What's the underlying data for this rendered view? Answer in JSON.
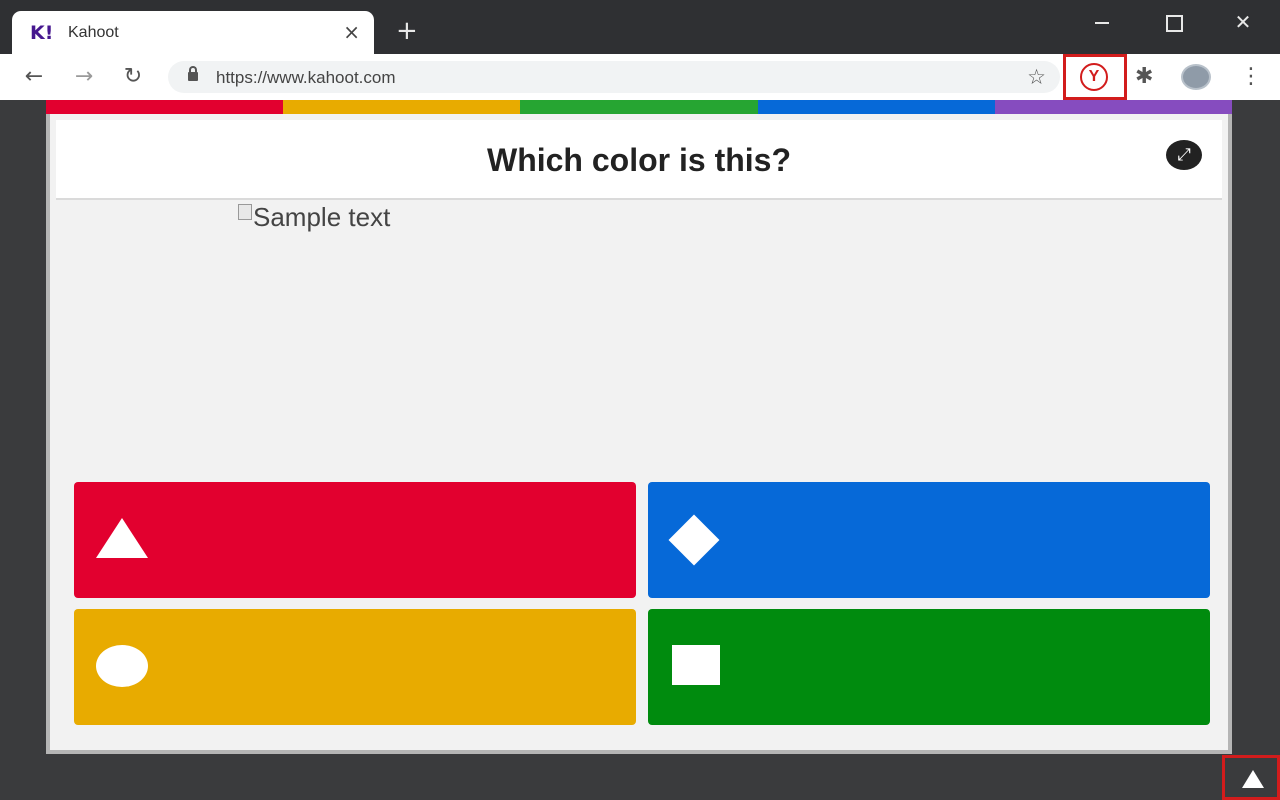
{
  "browser": {
    "tab": {
      "favicon": "K!",
      "title": "Kahoot"
    },
    "url": "https://www.kahoot.com",
    "extension_icon_label": "Y",
    "icons": {
      "back": "←",
      "forward": "→",
      "reload": "↻",
      "star": "☆",
      "puzzle": "✱",
      "menu": "⋮",
      "new_tab": "+",
      "close_tab": "×",
      "window_close": "✕"
    }
  },
  "stripe_colors": [
    "#e2002f",
    "#e8ab00",
    "#26a532",
    "#0669d8",
    "#864cbf"
  ],
  "quiz": {
    "question": "Which color is this?",
    "image_alt": "Sample text",
    "expand_icon": "⤢",
    "answers": [
      {
        "color": "#e2002f",
        "shape": "triangle"
      },
      {
        "color": "#0669d8",
        "shape": "diamond"
      },
      {
        "color": "#e8ab00",
        "shape": "circle"
      },
      {
        "color": "#008b0e",
        "shape": "square"
      }
    ]
  }
}
